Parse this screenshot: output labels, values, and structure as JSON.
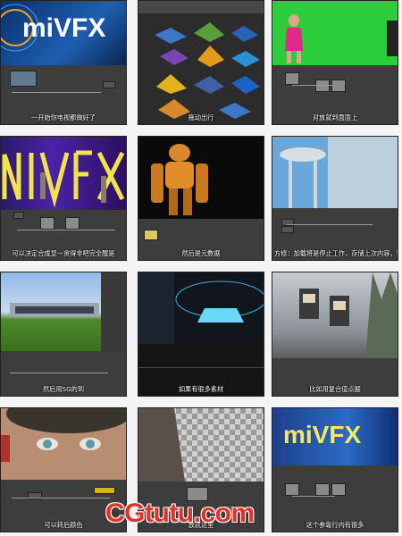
{
  "watermark": "CGtutu.com",
  "tiles": [
    {
      "caption": "一开始你电视都做好了",
      "logo": "miVFX"
    },
    {
      "caption": "拖动出行"
    },
    {
      "caption": "对放就到面面上"
    },
    {
      "caption": "可以决定合成显一贪得非吧完全醒是"
    },
    {
      "caption": "然后是元数据"
    },
    {
      "caption": "方修：加载将是停止工作，存储上次内容，输出比在全为讯 ·你的应"
    },
    {
      "caption": "然后用SG的到"
    },
    {
      "caption": "如果有很多素材"
    },
    {
      "caption": "比如用复合值点据"
    },
    {
      "caption": "可以转后颜色"
    },
    {
      "caption": "放就这里"
    },
    {
      "caption": "这个参靠行内有很多",
      "logo": "miVFX"
    }
  ]
}
